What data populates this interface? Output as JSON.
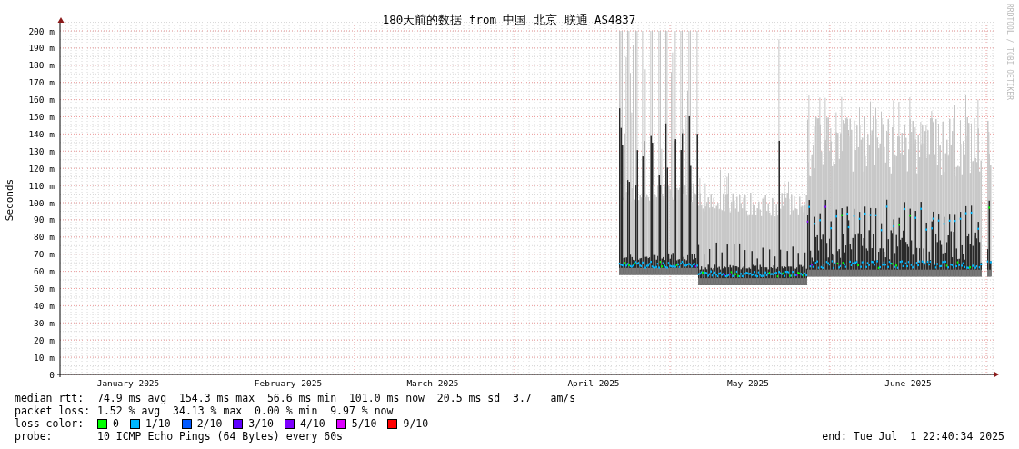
{
  "title": "180天前的数据 from 中国 北京 联通 AS4837",
  "y_axis": {
    "label": "Seconds",
    "ticks": [
      "200 m",
      "190 m",
      "180 m",
      "170 m",
      "160 m",
      "150 m",
      "140 m",
      "130 m",
      "120 m",
      "110 m",
      "100 m",
      "90 m",
      "80 m",
      "70 m",
      "60 m",
      "50 m",
      "40 m",
      "30 m",
      "20 m",
      "10 m",
      "0"
    ]
  },
  "x_axis": {
    "ticks": [
      "January 2025",
      "February 2025",
      "March 2025",
      "April 2025",
      "May 2025",
      "June 2025"
    ]
  },
  "side_text": "RRDTOOL / TOBI OETIKER",
  "stats": [
    {
      "label": "median rtt:",
      "value": "74.9 ms avg  154.3 ms max  56.6 ms min  101.0 ms now  20.5 ms sd  3.7   am/s"
    },
    {
      "label": "packet loss:",
      "value": "1.52 % avg  34.13 % max  0.00 % min  9.97 % now"
    }
  ],
  "loss_color": {
    "label": "loss color:",
    "items": [
      {
        "label": "0",
        "color": "#00ff00"
      },
      {
        "label": "1/10",
        "color": "#00b8ff"
      },
      {
        "label": "2/10",
        "color": "#0059ff"
      },
      {
        "label": "3/10",
        "color": "#5e00ff"
      },
      {
        "label": "4/10",
        "color": "#7e00ff"
      },
      {
        "label": "5/10",
        "color": "#dd00ff"
      },
      {
        "label": "9/10",
        "color": "#ff0000"
      }
    ]
  },
  "probe": {
    "label": "probe:",
    "value": "10 ICMP Echo Pings (64 Bytes) every 60s"
  },
  "end": "end: Tue Jul  1 22:40:34 2025"
}
